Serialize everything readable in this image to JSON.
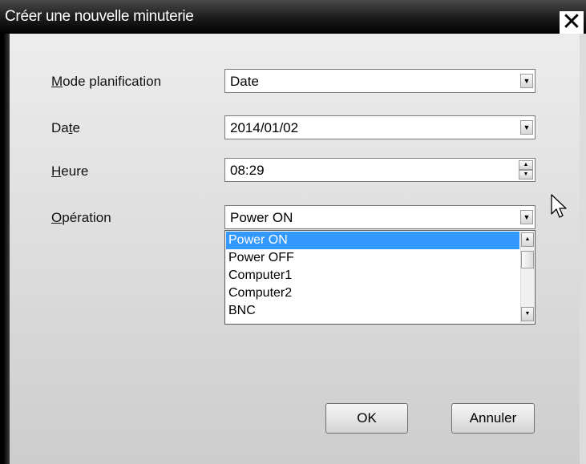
{
  "dialog": {
    "title": "Créer une nouvelle minuterie",
    "close_label": "✕"
  },
  "form": {
    "mode": {
      "label_ul": "M",
      "label_rest": "ode planification",
      "value": "Date"
    },
    "date": {
      "label_pre": "Da",
      "label_ul": "t",
      "label_rest": "e",
      "value": "2014/01/02"
    },
    "heure": {
      "label_ul": "H",
      "label_rest": "eure",
      "value": "08:29"
    },
    "operation": {
      "label_ul": "O",
      "label_rest": "pération",
      "value": "Power ON"
    }
  },
  "operation_list": {
    "items": [
      "Power ON",
      "Power OFF",
      "Computer1",
      "Computer2",
      "BNC"
    ],
    "selected_index": 0
  },
  "buttons": {
    "ok_label": "OK",
    "cancel_label": "Annuler"
  },
  "icons": {
    "dropdown": "chevron-down-icon",
    "spin_up": "spin-up-icon",
    "spin_down": "spin-down-icon",
    "scroll_up": "scroll-up-icon",
    "scroll_down": "scroll-down-icon",
    "close": "close-icon",
    "cursor": "mouse-pointer-icon"
  },
  "colors": {
    "selection": "#3399ff",
    "titlebar": "#000000"
  }
}
